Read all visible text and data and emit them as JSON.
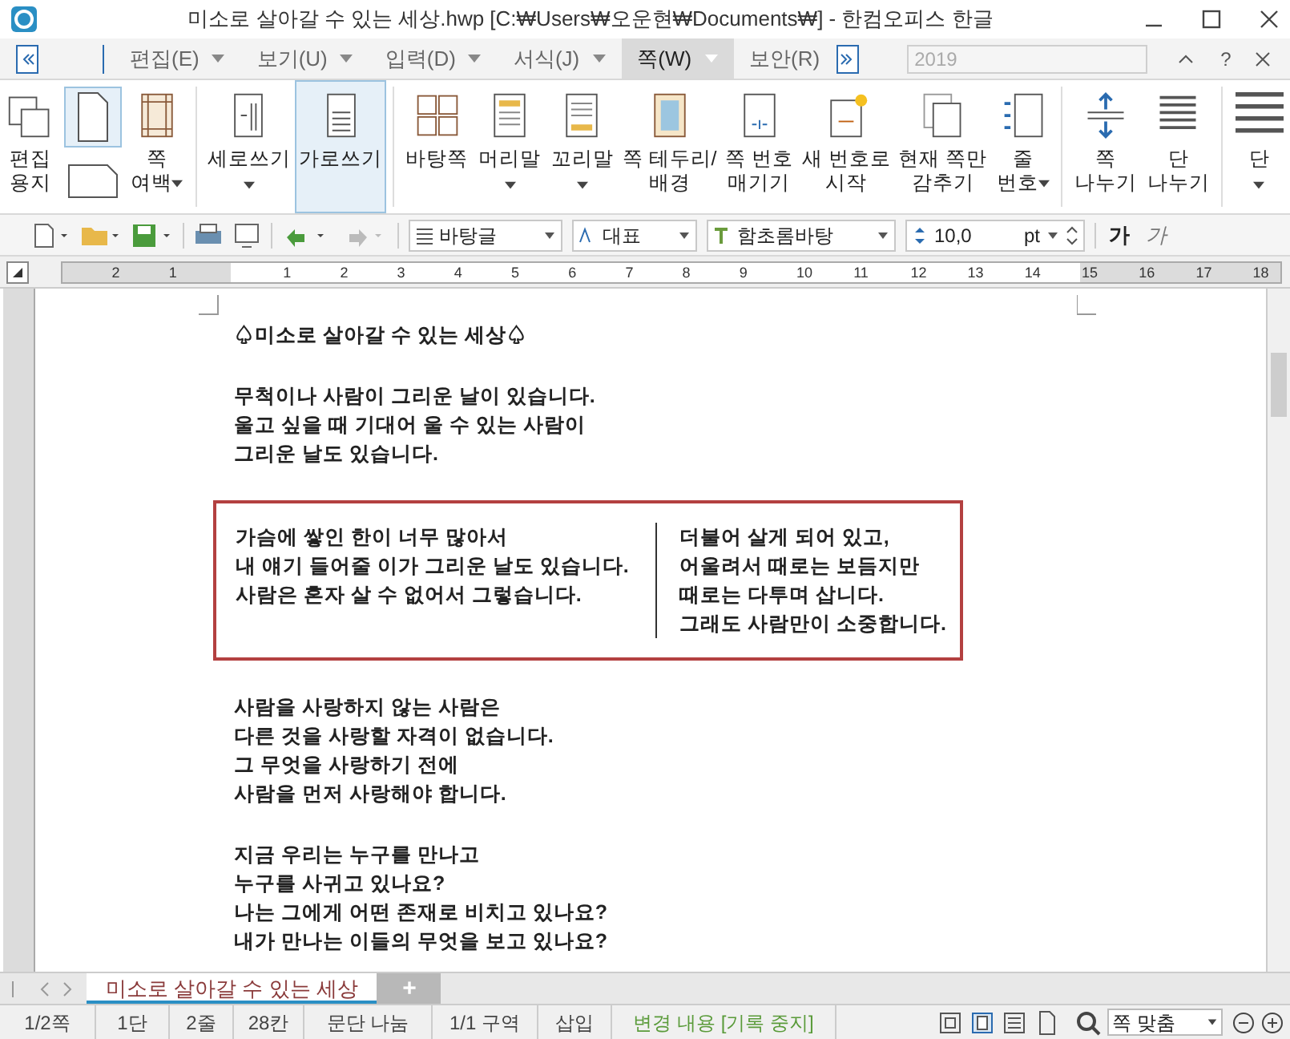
{
  "window": {
    "title": "미소로 살아갈 수 있는 세상.hwp [C:₩Users₩오운현₩Documents₩] - 한컴오피스 한글"
  },
  "menu_tabs": [
    {
      "label": "편집(E)",
      "selected": false
    },
    {
      "label": "보기(U)",
      "selected": false
    },
    {
      "label": "입력(D)",
      "selected": false
    },
    {
      "label": "서식(J)",
      "selected": false
    },
    {
      "label": "쪽(W)",
      "selected": true
    },
    {
      "label": "보안(R)",
      "selected": false
    }
  ],
  "year_field": {
    "value": "2019",
    "disabled": true
  },
  "help": "?",
  "ribbon": [
    {
      "kind": "button",
      "lines": [
        "편집",
        "용지"
      ],
      "dropdown": false,
      "selected": false
    },
    {
      "kind": "pair",
      "selected": true
    },
    {
      "kind": "button",
      "lines": [
        "쪽",
        "여백"
      ],
      "dropdown": true,
      "selected": false
    },
    {
      "kind": "sep"
    },
    {
      "kind": "button",
      "lines": [
        "세로쓰기"
      ],
      "dropdown": true,
      "selected": false
    },
    {
      "kind": "button",
      "lines": [
        "가로쓰기"
      ],
      "dropdown": false,
      "selected": true
    },
    {
      "kind": "sep"
    },
    {
      "kind": "button",
      "lines": [
        "바탕쪽"
      ],
      "dropdown": false,
      "selected": false
    },
    {
      "kind": "button",
      "lines": [
        "머리말"
      ],
      "dropdown": true,
      "selected": false
    },
    {
      "kind": "button",
      "lines": [
        "꼬리말"
      ],
      "dropdown": true,
      "selected": false
    },
    {
      "kind": "button",
      "lines": [
        "쪽 테두리/",
        "배경"
      ],
      "dropdown": false,
      "selected": false
    },
    {
      "kind": "button",
      "lines": [
        "쪽 번호",
        "매기기"
      ],
      "dropdown": false,
      "selected": false
    },
    {
      "kind": "button",
      "lines": [
        "새 번호로",
        "시작"
      ],
      "dropdown": false,
      "selected": false
    },
    {
      "kind": "button",
      "lines": [
        "현재 쪽만",
        "감추기"
      ],
      "dropdown": false,
      "selected": false
    },
    {
      "kind": "button",
      "lines": [
        "줄",
        "번호"
      ],
      "dropdown": true,
      "selected": false
    },
    {
      "kind": "sep"
    },
    {
      "kind": "button",
      "lines": [
        "쪽",
        "나누기"
      ],
      "dropdown": false,
      "selected": false
    },
    {
      "kind": "button",
      "lines": [
        "단",
        "나누기"
      ],
      "dropdown": false,
      "selected": false
    },
    {
      "kind": "sep"
    },
    {
      "kind": "button",
      "lines": [
        "단"
      ],
      "dropdown": true,
      "selected": false
    }
  ],
  "toolbar": {
    "style": "바탕글",
    "language": "대표",
    "font": "함초롬바탕",
    "size": "10,0",
    "unit": "pt",
    "bold": "가",
    "italic": "가"
  },
  "ruler": {
    "labels": [
      "2",
      "1",
      "1",
      "2",
      "3",
      "4",
      "5",
      "6",
      "7",
      "8",
      "9",
      "10",
      "11",
      "12",
      "13",
      "14",
      "15",
      "16",
      "17",
      "18"
    ]
  },
  "document": {
    "title": "♤미소로 살아갈 수 있는 세상♤",
    "paragraphs_before": [
      [
        "무척이나 사람이 그리운 날이 있습니다.",
        "울고 싶을 때 기대어 울 수 있는 사람이",
        "그리운 날도 있습니다."
      ]
    ],
    "box": {
      "left": [
        "가슴에 쌓인 한이 너무 많아서",
        "내 얘기 들어줄 이가 그리운 날도 있습니다.",
        "사람은 혼자 살 수 없어서 그렇습니다."
      ],
      "right": [
        "더불어 살게 되어 있고,",
        "어울려서 때로는 보듬지만",
        "때로는 다투며 삽니다.",
        "그래도 사람만이 소중합니다."
      ]
    },
    "paragraphs_after": [
      [
        "사람을 사랑하지 않는 사람은",
        "다른 것을 사랑할 자격이 없습니다.",
        "그 무엇을 사랑하기 전에",
        "사람을 먼저 사랑해야 합니다."
      ],
      [
        "지금 우리는 누구를 만나고",
        "누구를 사귀고 있나요?",
        "나는 그에게 어떤 존재로 비치고 있나요?",
        "내가 만나는 이들의 무엇을 보고 있나요?"
      ]
    ]
  },
  "doc_tabs": [
    {
      "label": "미소로 살아갈 수 있는 세상",
      "selected": true
    }
  ],
  "add_tab": "+",
  "status_bar": {
    "items": [
      {
        "text": "1/2쪽",
        "kind": "plain"
      },
      {
        "text": "1단",
        "kind": "plain"
      },
      {
        "text": "2줄",
        "kind": "plain"
      },
      {
        "text": "28칸",
        "kind": "plain"
      },
      {
        "text": "문단 나눔",
        "kind": "plain"
      },
      {
        "text": "1/1 구역",
        "kind": "plain"
      },
      {
        "text": "삽입",
        "kind": "plain"
      },
      {
        "text": "변경 내용 [기록 중지]",
        "kind": "track"
      }
    ],
    "zoom": "쪽 맞춤"
  }
}
